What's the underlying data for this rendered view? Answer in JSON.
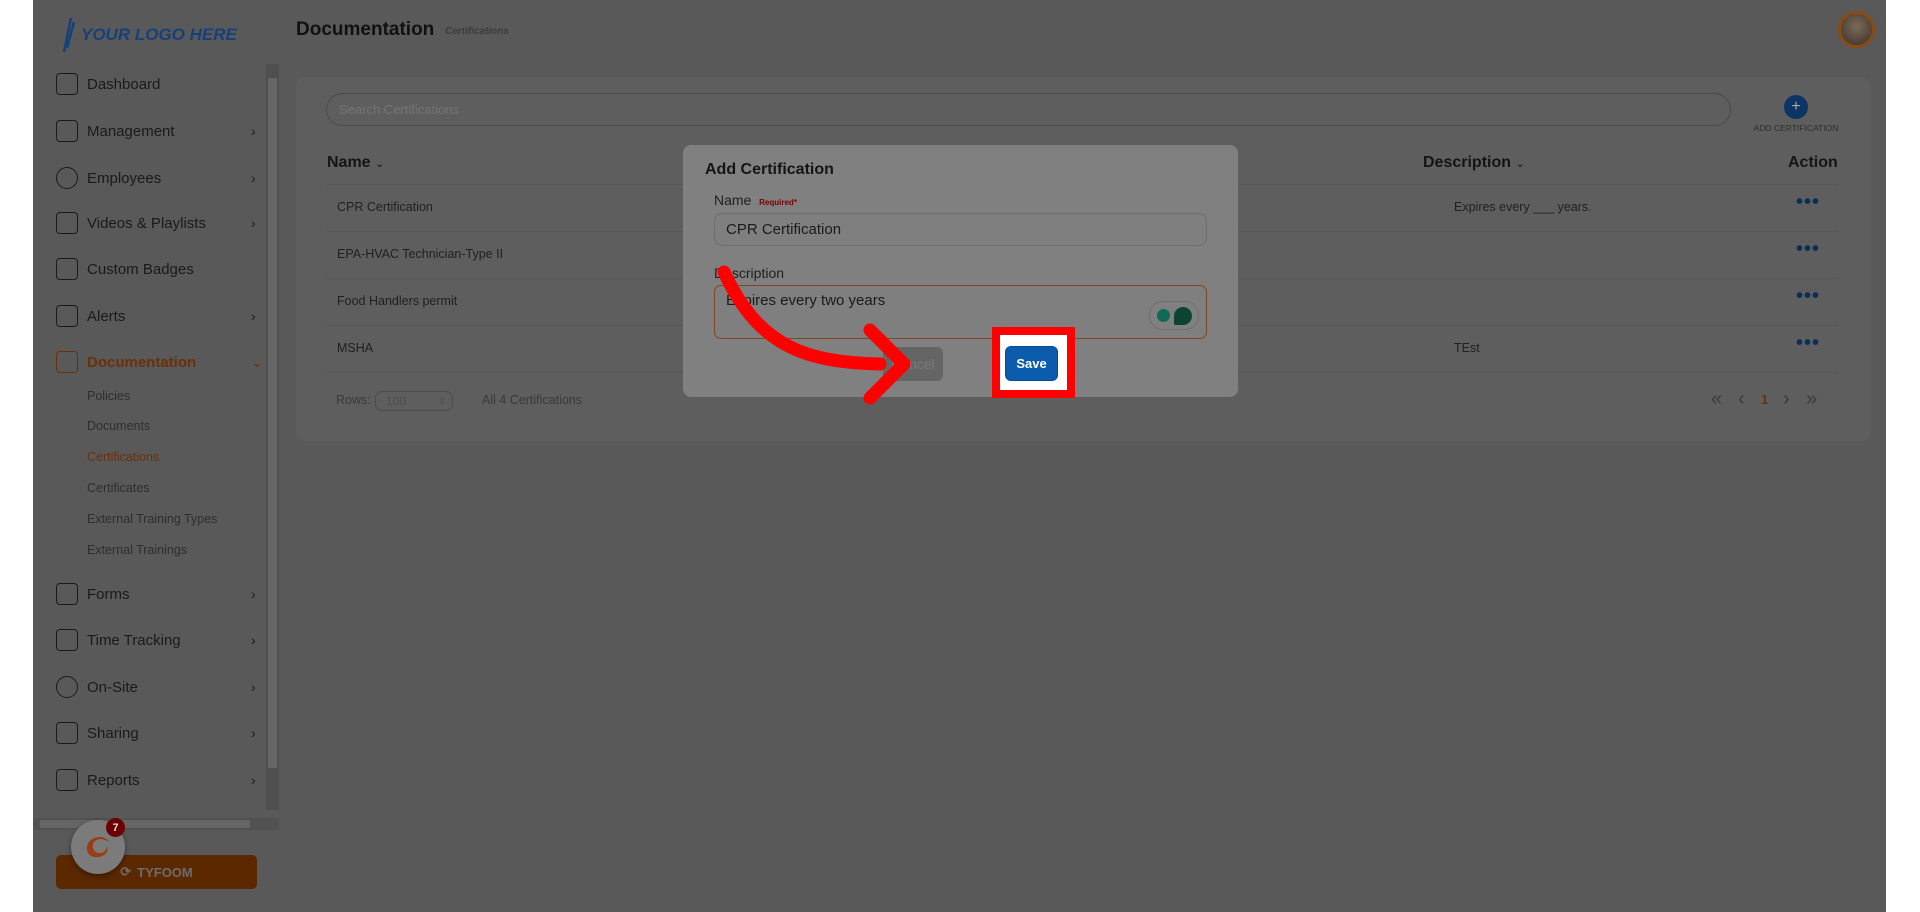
{
  "header": {
    "logo": "YOUR LOGO HERE",
    "title": "Documentation",
    "subtitle": "Certifications"
  },
  "sidebar": {
    "items": [
      {
        "label": "Dashboard",
        "icon": "dashboard-icon",
        "chevron": false
      },
      {
        "label": "Management",
        "icon": "people-icon",
        "chevron": true
      },
      {
        "label": "Employees",
        "icon": "person-icon",
        "chevron": true
      },
      {
        "label": "Videos & Playlists",
        "icon": "play-icon",
        "chevron": true
      },
      {
        "label": "Custom Badges",
        "icon": "badge-icon",
        "chevron": false
      },
      {
        "label": "Alerts",
        "icon": "chat-icon",
        "chevron": true
      },
      {
        "label": "Documentation",
        "icon": "document-icon",
        "chevron": true,
        "active": true
      },
      {
        "label": "Forms",
        "icon": "list-icon",
        "chevron": true
      },
      {
        "label": "Time Tracking",
        "icon": "stopwatch-icon",
        "chevron": true
      },
      {
        "label": "On-Site",
        "icon": "location-icon",
        "chevron": true
      },
      {
        "label": "Sharing",
        "icon": "share-user-icon",
        "chevron": true
      },
      {
        "label": "Reports",
        "icon": "bar-chart-icon",
        "chevron": true
      }
    ],
    "subitems": [
      "Policies",
      "Documents",
      "Certifications",
      "Certificates",
      "External Training Types",
      "External Trainings"
    ],
    "active_subitem": "Certifications",
    "brand_button": "TYFOOM",
    "notification_count": "7"
  },
  "main": {
    "search_placeholder": "Search Certifications",
    "add_label": "ADD CERTIFICATION",
    "columns": {
      "name": "Name",
      "description": "Description",
      "action": "Action"
    },
    "rows": [
      {
        "name": "CPR Certification",
        "description": "Expires every ___ years."
      },
      {
        "name": "EPA-HVAC Technician-Type II",
        "description": ""
      },
      {
        "name": "Food Handlers permit",
        "description": ""
      },
      {
        "name": "MSHA",
        "description": "TEst"
      }
    ],
    "rows_label": "Rows:",
    "rows_value": "100",
    "count_text": "All 4 Certifications",
    "current_page": "1"
  },
  "modal": {
    "title": "Add Certification",
    "name_label": "Name",
    "required": "Required*",
    "name_value": "CPR Certification",
    "description_label": "Description",
    "description_value": "Expires every two years",
    "cancel": "Cancel",
    "save": "Save"
  },
  "colors": {
    "accent": "#d9651b",
    "primary": "#0b5cad",
    "highlight": "#ff0000"
  }
}
